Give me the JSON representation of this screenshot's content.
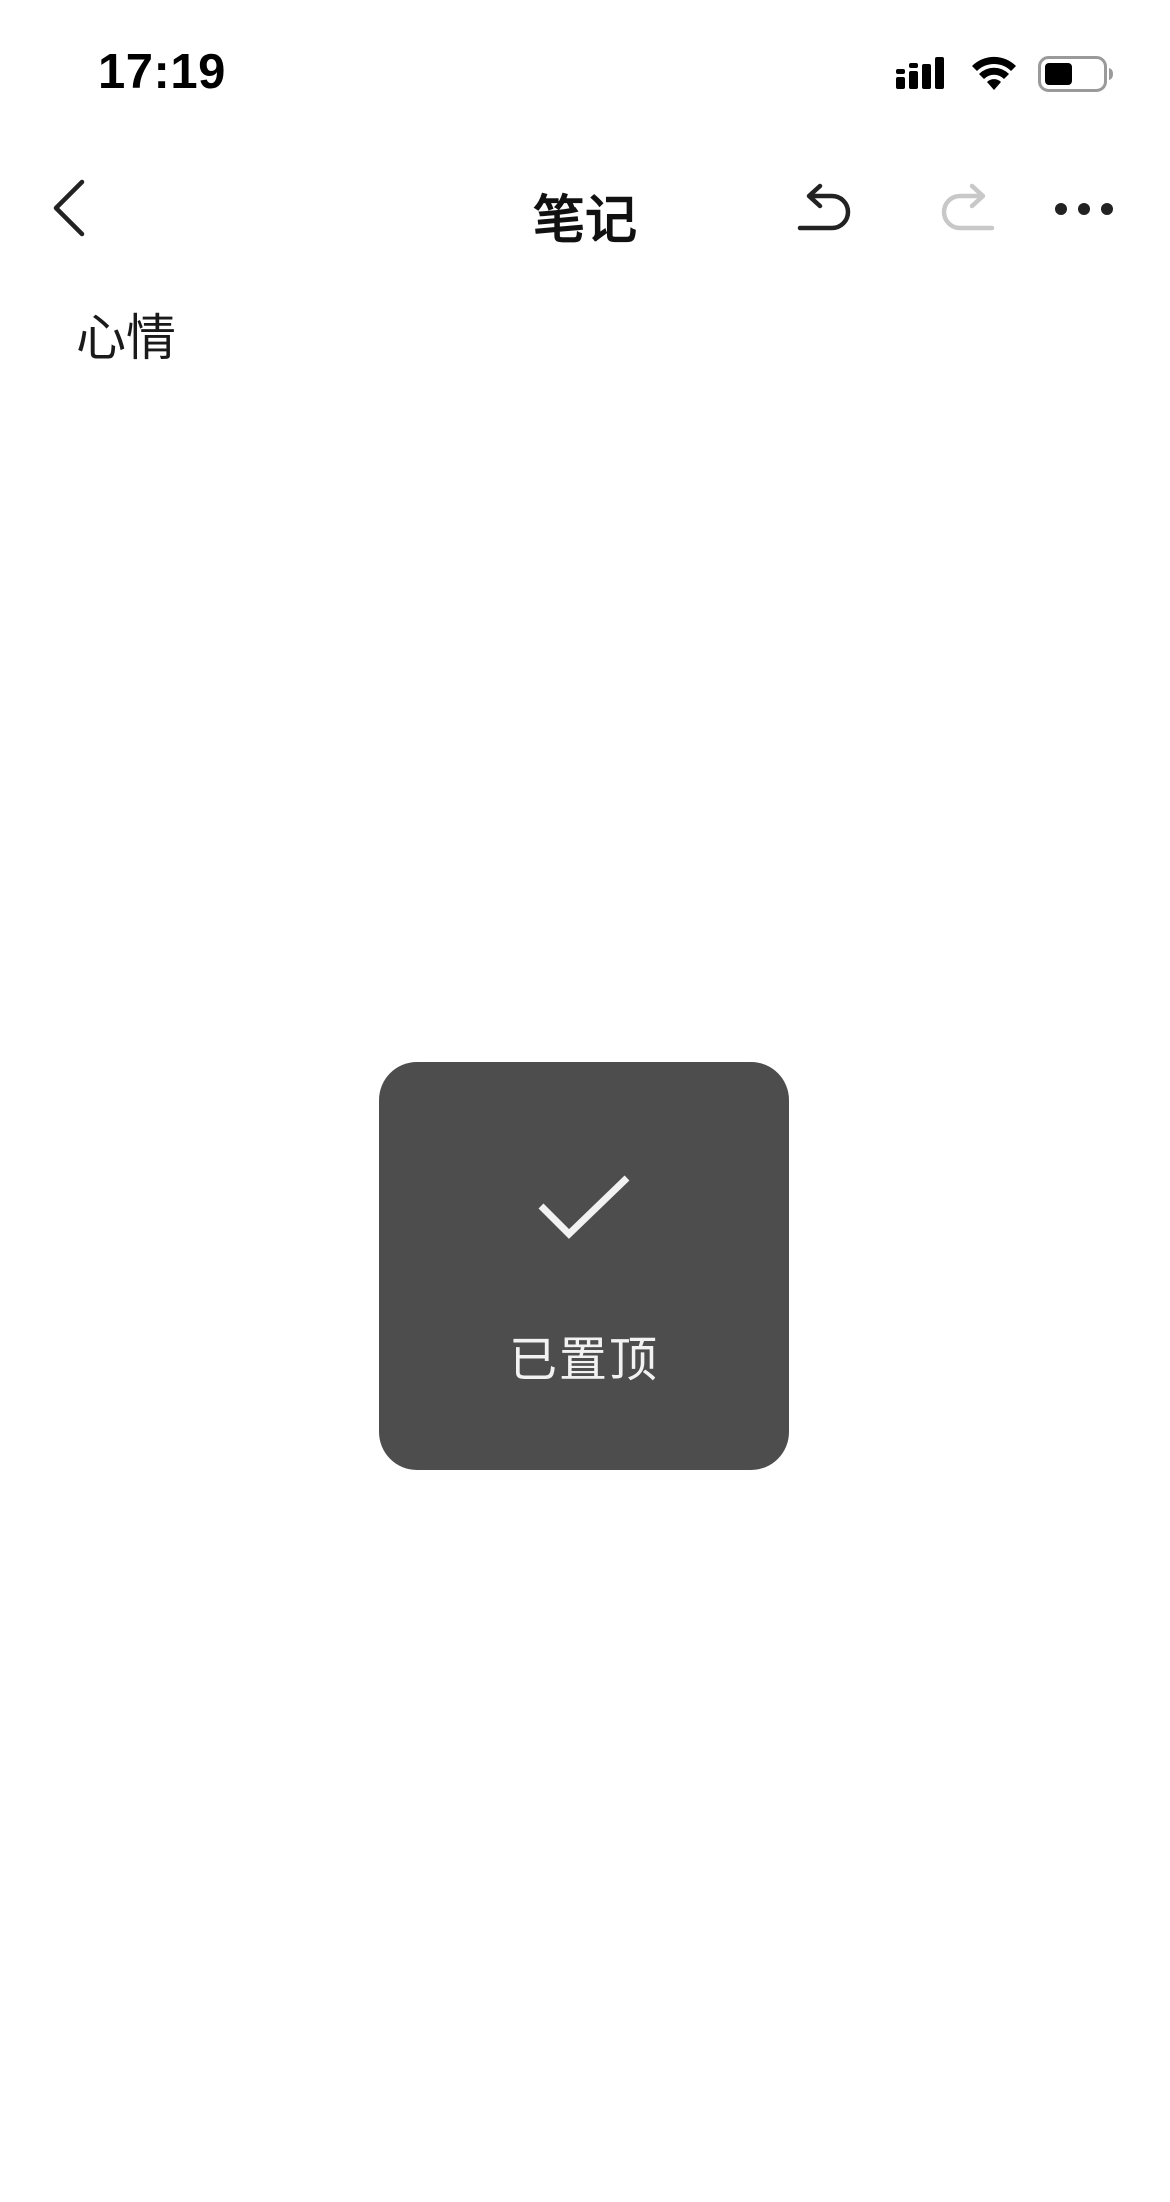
{
  "status_bar": {
    "time": "17:19",
    "icons": [
      "cellular-signal-icon",
      "wifi-icon",
      "battery-icon"
    ]
  },
  "nav": {
    "title": "笔记",
    "back_icon": "chevron-left-icon",
    "undo_icon": "undo-icon",
    "redo_icon": "redo-icon",
    "more_icon": "more-horizontal-icon"
  },
  "note": {
    "content": "心情"
  },
  "toast": {
    "icon": "checkmark-icon",
    "message": "已置顶"
  },
  "colors": {
    "background": "#ffffff",
    "text_primary": "#111111",
    "icon_disabled": "#c8c8c8",
    "toast_background": "#4d4d4d",
    "toast_text": "#f2f2f2"
  }
}
